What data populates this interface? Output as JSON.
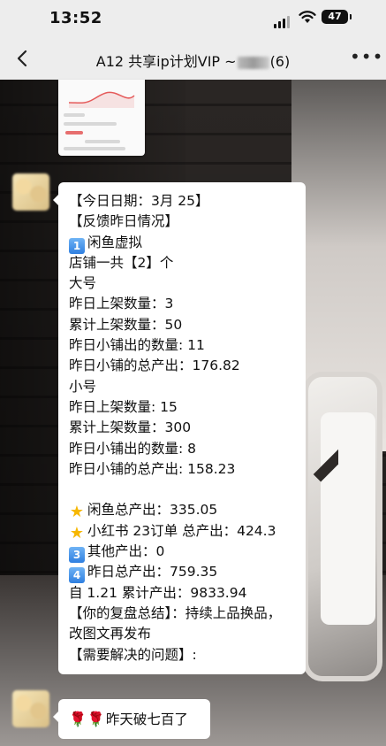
{
  "status_bar": {
    "time": "13:52",
    "battery": "47"
  },
  "nav": {
    "back_icon": "chevron-left-icon",
    "title_prefix": "A12 共享ip计划VIP ~",
    "title_suffix": "(6)",
    "more_icon": "more-dots-icon"
  },
  "messages": {
    "report": {
      "lines": [
        {
          "text": "【今日日期：3月 25】"
        },
        {
          "text": "【反馈昨日情况】"
        },
        {
          "badge": "1",
          "text": "闲鱼虚拟"
        },
        {
          "text": "店铺一共【2】个"
        },
        {
          "text": "大号"
        },
        {
          "text": "昨日上架数量：3"
        },
        {
          "text": "累计上架数量：50"
        },
        {
          "text": "昨日小铺出的数量: 11"
        },
        {
          "text": "昨日小铺的总产出：176.82"
        },
        {
          "text": "小号"
        },
        {
          "text": "昨日上架数量: 15"
        },
        {
          "text": "累计上架数量：300"
        },
        {
          "text": "昨日小铺出的数量: 8"
        },
        {
          "text": "昨日小铺的总产出: 158.23"
        },
        {
          "text": ""
        },
        {
          "star": true,
          "text": "闲鱼总产出：335.05"
        },
        {
          "star": true,
          "text": "小红书 23订单 总产出：424.3"
        },
        {
          "badge": "3",
          "text": "其他产出：0"
        },
        {
          "badge": "4",
          "text": "昨日总产出：759.35"
        },
        {
          "text": "自 1.21 累计产出：9833.94"
        },
        {
          "text": "【你的复盘总结】：持续上品换品，"
        },
        {
          "text": "改图文再发布"
        },
        {
          "text": "【需要解决的问题】:"
        }
      ]
    },
    "short": {
      "text": "昨天破七百了"
    }
  }
}
